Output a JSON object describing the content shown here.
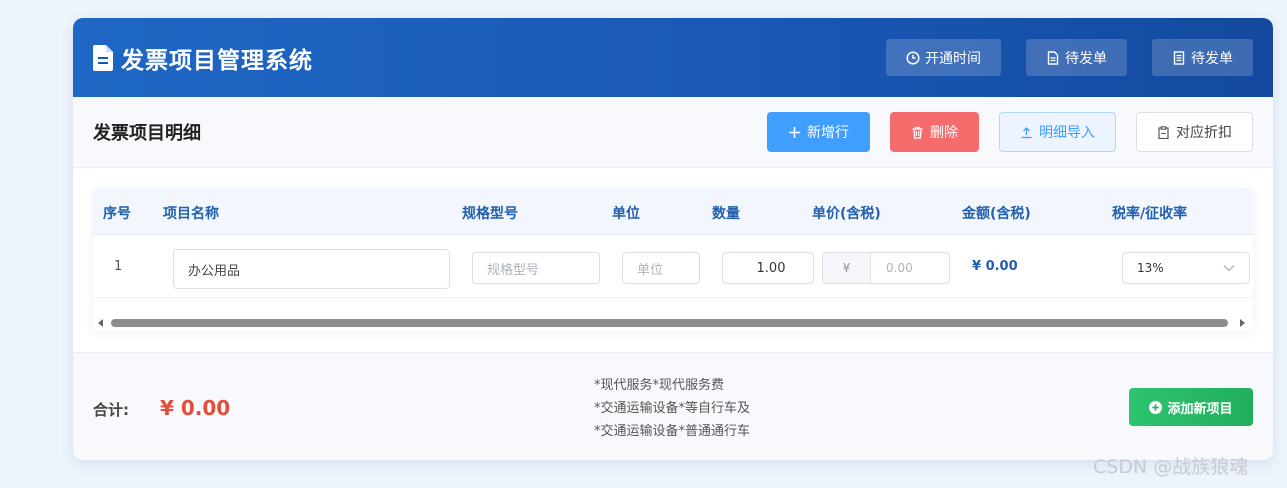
{
  "header": {
    "title": "发票项目管理系统",
    "buttons": [
      {
        "label": "开通时间",
        "icon": "clock-icon"
      },
      {
        "label": "待发单",
        "icon": "document-icon"
      },
      {
        "label": "待发单",
        "icon": "list-document-icon"
      }
    ]
  },
  "toolbar": {
    "subtitle": "发票项目明细",
    "add_row": "新增行",
    "delete": "删除",
    "import": "明细导入",
    "fold": "对应折扣"
  },
  "table": {
    "columns": [
      "序号",
      "项目名称",
      "规格型号",
      "单位",
      "数量",
      "单价(含税)",
      "金额(含税)",
      "税率/征收率"
    ],
    "rows": [
      {
        "index": "1",
        "name": "办公用品",
        "spec_placeholder": "规格型号",
        "unit_placeholder": "单位",
        "quantity": "1.00",
        "price_prefix": "¥",
        "price_placeholder": "0.00",
        "amount": "¥ 0.00",
        "tax_rate": "13%"
      }
    ]
  },
  "footer": {
    "total_label": "合计:",
    "total_value": "¥ 0.00",
    "notes": [
      "*现代服务*现代服务费",
      "*交通运输设备*等自行车及",
      "*交通运输设备*普通通行车"
    ],
    "add_button": "添加新项目"
  },
  "watermark": "CSDN @战族狼魂",
  "colors": {
    "header_bg": "#1a58b6",
    "primary": "#409eff",
    "danger": "#f56c6c",
    "success": "#2ec46f",
    "total_red": "#e34d3a"
  }
}
